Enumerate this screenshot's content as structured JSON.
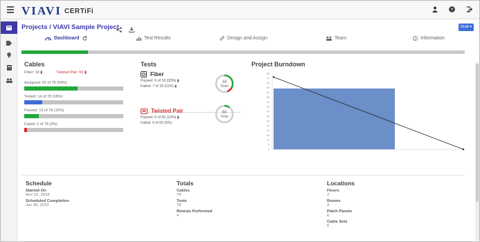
{
  "app": {
    "brand": "VIAVI",
    "product": "CERTiFi"
  },
  "breadcrumb": {
    "root": "Projects",
    "separator": "/",
    "project": "VIAVI Sample Project"
  },
  "header": {
    "draft_label": "Draft ▾"
  },
  "tabs": [
    {
      "label": "Dashboard",
      "icon": "dashboard-icon",
      "active": true
    },
    {
      "label": "Test Results",
      "icon": "bar-chart-icon",
      "active": false
    },
    {
      "label": "Design and Assign",
      "icon": "pencil-icon",
      "active": false
    },
    {
      "label": "Team",
      "icon": "team-icon",
      "active": false
    },
    {
      "label": "Information",
      "icon": "info-icon",
      "active": false
    }
  ],
  "project_progress": {
    "percent": 15,
    "color": "#22a839"
  },
  "cables": {
    "title": "Cables",
    "fiber": "Fiber: 18",
    "twisted_pair": "Twisted Pair: 60",
    "assigned": {
      "label": "Assigned: 42 of 78 (54%)",
      "percent": 54,
      "color": "#22a839"
    },
    "tested": {
      "label": "Tested: 14 of 78 (18%)",
      "percent": 18,
      "color": "#3e6fd8"
    },
    "passed": {
      "label": "Passed: 12 of 78 (15%)",
      "percent": 15,
      "color": "#22a839"
    },
    "failed": {
      "label": "Failed: 2 of 78 (3%)",
      "percent": 3,
      "color": "#d9262b"
    }
  },
  "tests": {
    "title": "Tests",
    "fiber": {
      "name": "Fiber",
      "passed": "Passed: 6 of 18 (33%)",
      "failed": "Failed: 7 of 18 (11%)",
      "donut_value": "18",
      "donut_unit": "Tests",
      "passed_fraction": 0.33,
      "failed_fraction": 0.11
    },
    "twisted_pair": {
      "name": "Twisted Pair",
      "passed": "Passed: 6 of 60 (10%)",
      "failed": "Failed: 0 of 60 (0%)",
      "donut_value": "60",
      "donut_unit": "Tests",
      "passed_fraction": 0.1,
      "failed_fraction": 0
    }
  },
  "chart_data": {
    "type": "bar",
    "title": "Project Burndown",
    "bar_color": "#6b8fc9",
    "line_color": "#222222",
    "ylim": [
      0,
      80
    ],
    "yticks": [
      0,
      5,
      10,
      15,
      20,
      25,
      30,
      35,
      40,
      45,
      50,
      55,
      60,
      65,
      70,
      75,
      80
    ],
    "bar": {
      "value": 64
    },
    "line": {
      "start": 76,
      "end": 0
    }
  },
  "schedule": {
    "title": "Schedule",
    "started_label": "Started On",
    "started_value": "Nov 22, 2018",
    "completion_label": "Scheduled Completion",
    "completion_value": "Jun 30, 2019"
  },
  "totals": {
    "title": "Totals",
    "cables_label": "Cables",
    "cables_value": "78",
    "tests_label": "Tests",
    "tests_value": "78",
    "retests_label": "Retests Performed",
    "retests_value": "4"
  },
  "locations": {
    "title": "Locations",
    "floors_label": "Floors",
    "floors_value": "2",
    "rooms_label": "Rooms",
    "rooms_value": "4",
    "panels_label": "Patch Panels",
    "panels_value": "6",
    "sets_label": "Cable Sets",
    "sets_value": "6"
  }
}
